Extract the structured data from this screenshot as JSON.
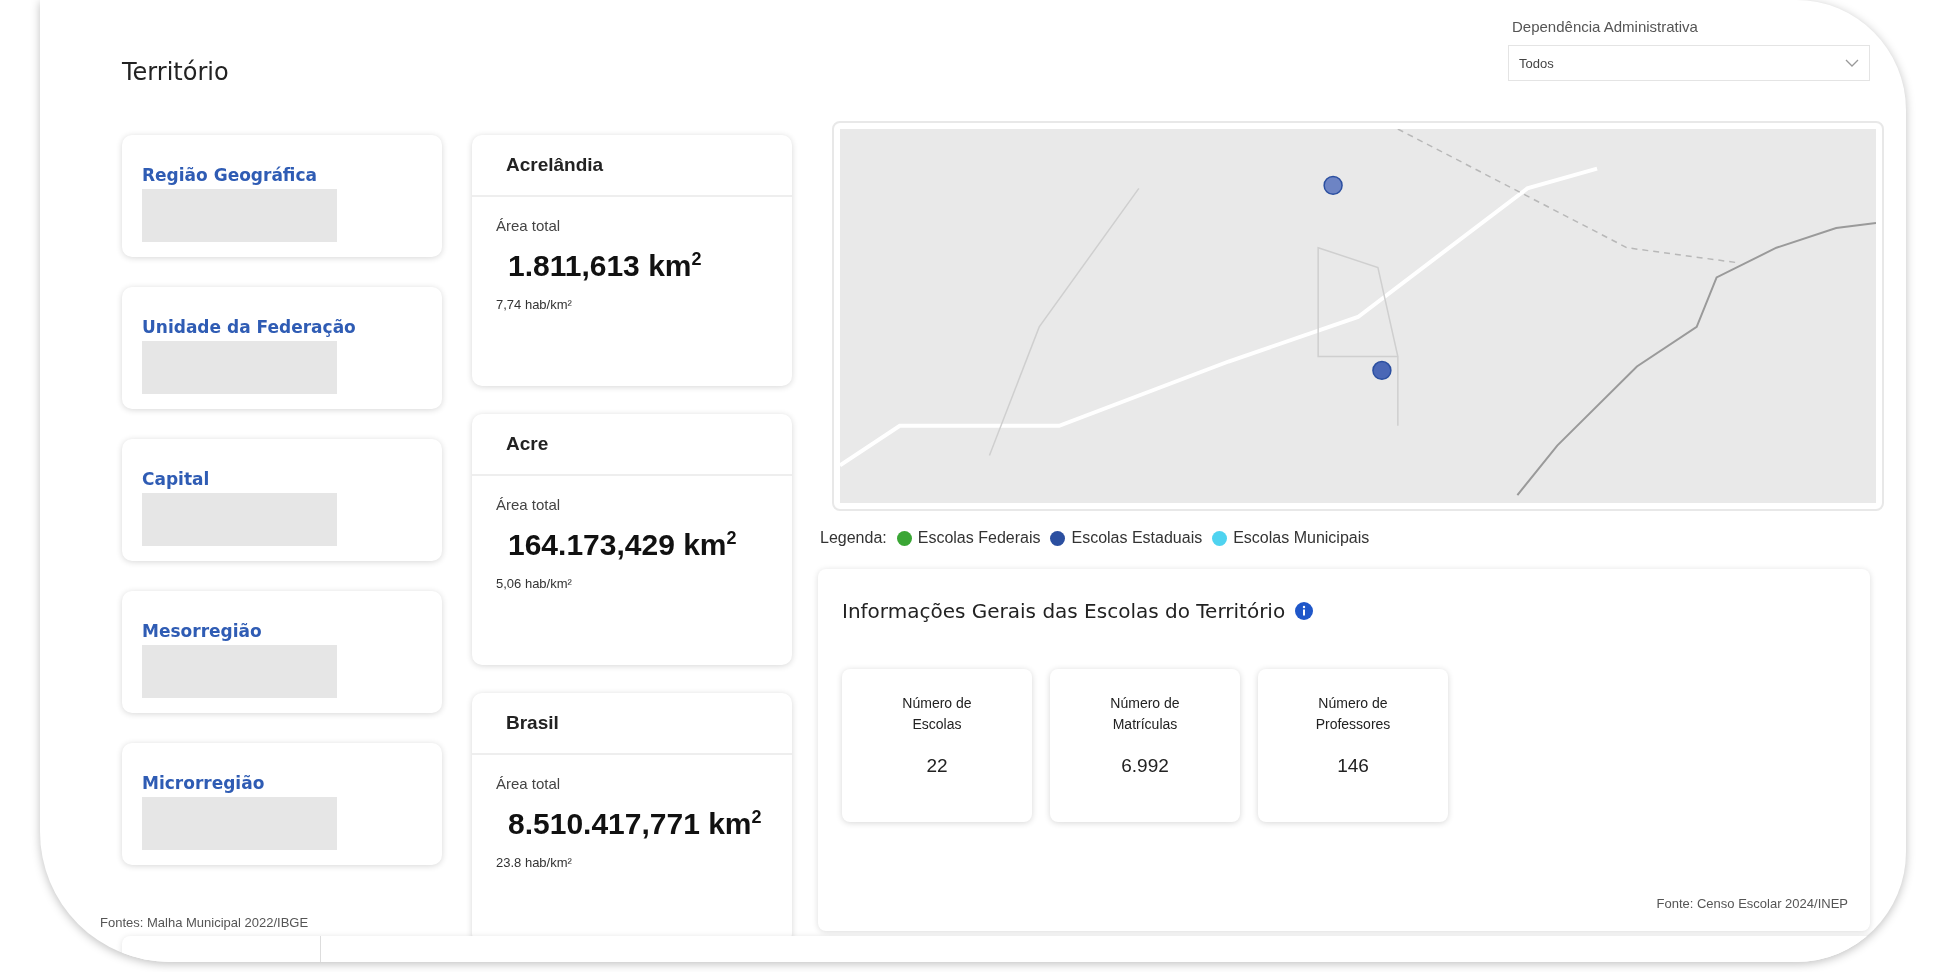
{
  "title": "Território",
  "filter": {
    "label": "Dependência Administrativa",
    "value": "Todos"
  },
  "territory_cards": [
    {
      "label": "Região Geográfica"
    },
    {
      "label": "Unidade da Federação"
    },
    {
      "label": "Capital"
    },
    {
      "label": "Mesorregião"
    },
    {
      "label": "Microrregião"
    }
  ],
  "area_cards": [
    {
      "name": "Acrelândia",
      "area_label": "Área total",
      "area": "1.811,613 km$^{2}$",
      "density": "7,74 hab/km²"
    },
    {
      "name": "Acre",
      "area_label": "Área total",
      "area": "164.173,429 km$^{2}$",
      "density": "5,06 hab/km²"
    },
    {
      "name": "Brasil",
      "area_label": "Área total",
      "area": "8.510.417,771 km$^{2}$",
      "density": "23.8 hab/km²"
    }
  ],
  "sources_note": "Fontes: Malha Municipal 2022/IBGE",
  "legend": {
    "label": "Legenda:",
    "items": [
      {
        "label": "Escolas Federais",
        "color": "#3aa635"
      },
      {
        "label": "Escolas Estaduais",
        "color": "#2b4fa0"
      },
      {
        "label": "Escolas Municipais",
        "color": "#4fd3f0"
      }
    ]
  },
  "school_info": {
    "title": "Informações Gerais das Escolas do Território",
    "stats": [
      {
        "label": "Número de Escolas",
        "value": "22"
      },
      {
        "label": "Número de Matrículas",
        "value": "6.992"
      },
      {
        "label": "Número de Professores",
        "value": "146"
      }
    ],
    "source": "Fonte: Censo Escolar 2024/INEP"
  }
}
